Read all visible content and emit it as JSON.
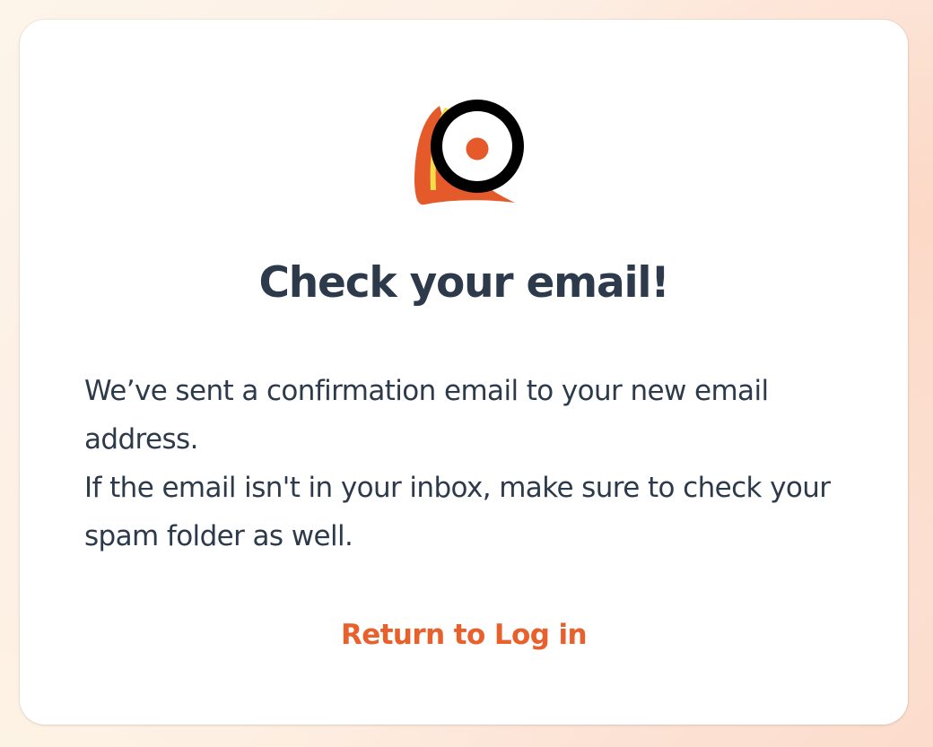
{
  "logo": {
    "icon": "puffin-eye-logo-icon",
    "colors": {
      "ring": "#000000",
      "pupil": "#e55a2b",
      "beak": "#e55a2b",
      "stripe": "#f5dc4a"
    }
  },
  "card": {
    "title": "Check your email!",
    "message_lines": [
      "We’ve sent a confirmation email to your new email address.",
      "If the email isn't in your inbox, make sure to check your spam folder as well."
    ],
    "return_link": "Return to Log in"
  },
  "colors": {
    "accent": "#e8602c",
    "text": "#2d3a4b",
    "card_background": "#ffffff"
  }
}
